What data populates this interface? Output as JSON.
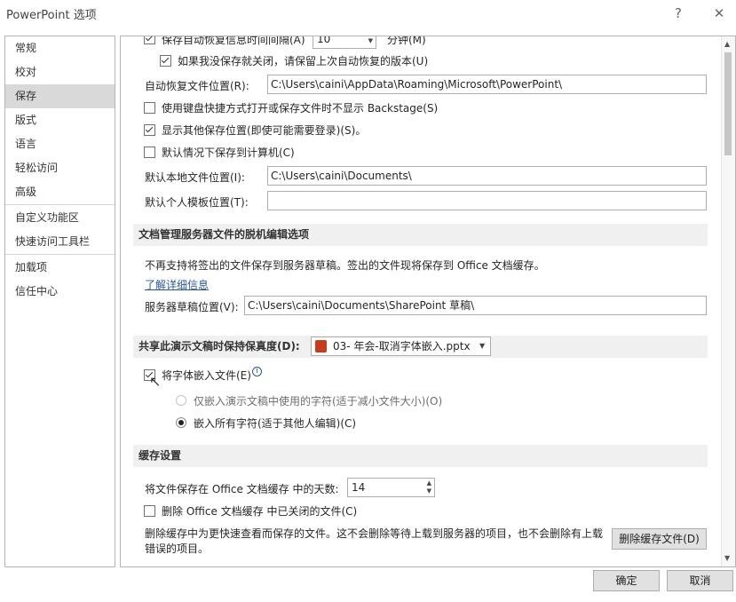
{
  "window": {
    "title": "PowerPoint 选项",
    "help": "?",
    "close": "✕"
  },
  "sidebar": {
    "items": [
      "常规",
      "校对",
      "保存",
      "版式",
      "语言",
      "轻松访问",
      "高级",
      "自定义功能区",
      "快速访问工具栏",
      "加载项",
      "信任中心"
    ],
    "active": "保存"
  },
  "content": {
    "autorecover_label": "保存自动恢复信息时间间隔(A)",
    "autorecover_minutes": "10",
    "minutes_unit": "分钟(M)",
    "keep_last_label": "如果我没保存就关闭，请保留上次自动恢复的版本(U)",
    "autorecover_path_label": "自动恢复文件位置(R):",
    "autorecover_path": "C:\\Users\\caini\\AppData\\Roaming\\Microsoft\\PowerPoint\\",
    "backstage_label": "使用键盘快捷方式打开或保存文件时不显示 Backstage(S)",
    "show_locations_label": "显示其他保存位置(即使可能需要登录)(S)。",
    "save_computer_label": "默认情况下保存到计算机(C)",
    "local_path_label": "默认本地文件位置(I):",
    "local_path": "C:\\Users\\caini\\Documents\\",
    "template_path_label": "默认个人模板位置(T):",
    "template_path": "",
    "offline_section": "文档管理服务器文件的脱机编辑选项",
    "offline_desc": "不再支持将签出的文件保存到服务器草稿。签出的文件现将保存到 Office 文档缓存。",
    "learn_more": "了解详细信息",
    "drafts_label": "服务器草稿位置(V):",
    "drafts_path": "C:\\Users\\caini\\Documents\\SharePoint 草稿\\",
    "fidelity_section": "共享此演示文稿时保持保真度(D):",
    "presentation_name": "03- 年会-取消字体嵌入.pptx",
    "embed_fonts_label": "将字体嵌入文件(E)",
    "embed_used_label": "仅嵌入演示文稿中使用的字符(适于减小文件大小)(O)",
    "embed_all_label": "嵌入所有字符(适于其他人编辑)(C)",
    "cache_section": "缓存设置",
    "cache_days_label": "将文件保存在 Office 文档缓存 中的天数:",
    "cache_days": "14",
    "delete_closed_label": "删除 Office 文档缓存 中已关闭的文件(C)",
    "delete_desc_1": "删除缓存中为更快速查看而保存的文件。这不会删除等待上载到服务器的项目，也不会删除有上载",
    "delete_desc_2": "错误的项目。",
    "delete_cache_button": "删除缓存文件(D)"
  },
  "footer": {
    "ok": "确定",
    "cancel": "取消"
  }
}
